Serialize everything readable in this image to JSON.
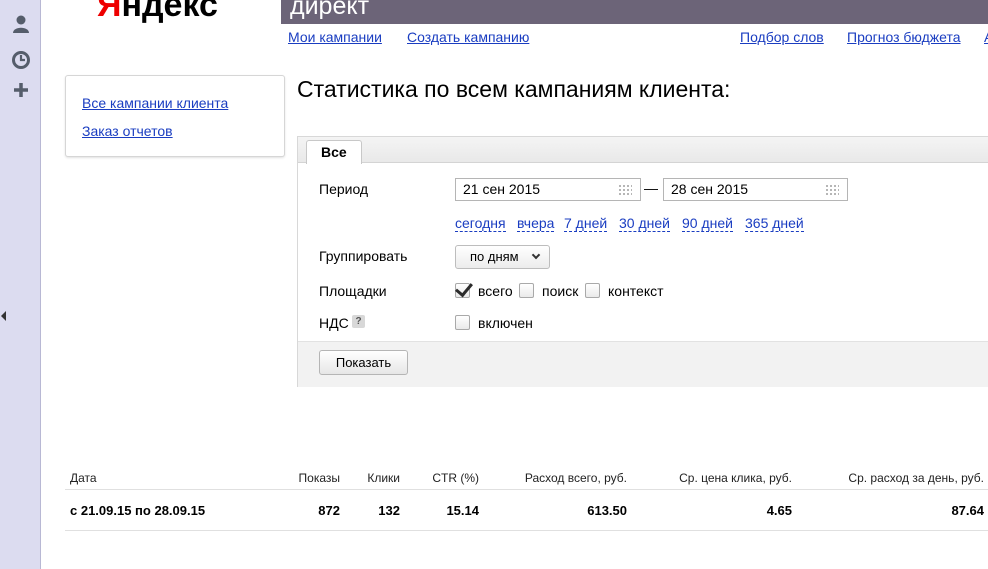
{
  "logo": {
    "first_letter": "Я",
    "rest": "ндекс"
  },
  "topbar": {
    "title": "директ"
  },
  "nav": {
    "my_campaigns": "Мои кампании",
    "create_campaign": "Создать кампанию",
    "word_selection": "Подбор слов",
    "budget_forecast": "Прогноз бюджета",
    "cut_link": "А"
  },
  "sidebar": {
    "items": [
      {
        "label": "Все кампании клиента"
      },
      {
        "label": "Заказ отчетов"
      }
    ]
  },
  "page_title": "Статистика по всем кампаниям клиента:",
  "filter": {
    "tab_label": "Все",
    "period_label": "Период",
    "date_from": "21 сен 2015",
    "date_separator": "—",
    "date_to": "28 сен 2015",
    "quick_ranges": [
      "сегодня",
      "вчера",
      "7 дней",
      "30 дней",
      "90 дней",
      "365 дней"
    ],
    "group_label": "Группировать",
    "group_value": "по дням",
    "platforms_label": "Площадки",
    "platforms": [
      {
        "label": "всего",
        "checked": true
      },
      {
        "label": "поиск",
        "checked": false
      },
      {
        "label": "контекст",
        "checked": false
      }
    ],
    "vat_label": "НДС",
    "vat_help": "?",
    "vat_option": "включен",
    "vat_checked": false,
    "show_button": "Показать"
  },
  "table": {
    "columns": [
      "Дата",
      "Показы",
      "Клики",
      "CTR (%)",
      "Расход всего, руб.",
      "Ср. цена клика, руб.",
      "Ср. расход за день, руб."
    ],
    "rows": [
      [
        "с 21.09.15 по 28.09.15",
        "872",
        "132",
        "15.14",
        "613.50",
        "4.65",
        "87.64"
      ]
    ]
  }
}
